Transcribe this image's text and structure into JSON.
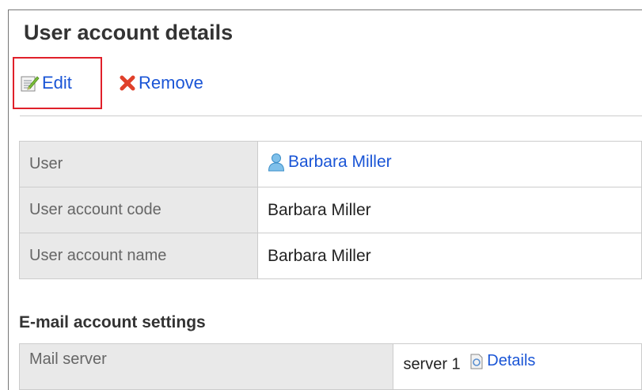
{
  "page": {
    "title": "User account details"
  },
  "toolbar": {
    "edit_label": "Edit",
    "remove_label": "Remove"
  },
  "details": {
    "rows": [
      {
        "label": "User",
        "value": "Barbara Miller",
        "link": true
      },
      {
        "label": "User account code",
        "value": "Barbara Miller",
        "link": false
      },
      {
        "label": "User account name",
        "value": "Barbara Miller",
        "link": false
      }
    ]
  },
  "email_section": {
    "title": "E-mail account settings",
    "rows": [
      {
        "label": "Mail server",
        "value": "server 1",
        "details_label": "Details"
      }
    ]
  },
  "colors": {
    "link": "#1a55d6",
    "highlight": "#e0202a",
    "label_bg": "#e9e9e9",
    "border": "#cccccc"
  },
  "icons": [
    "edit-icon",
    "remove-icon",
    "user-icon",
    "details-icon"
  ]
}
